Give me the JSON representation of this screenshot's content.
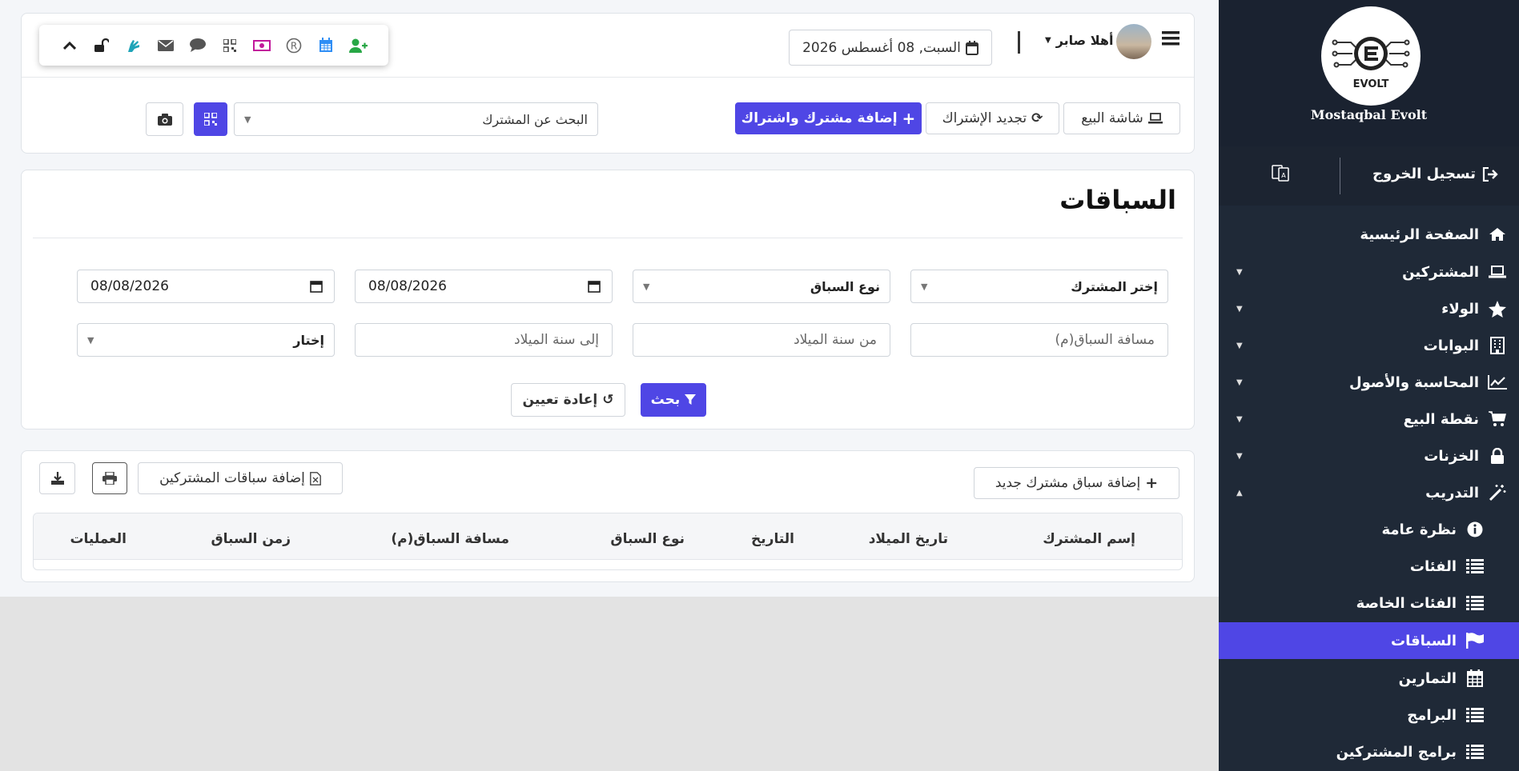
{
  "quickbar": {
    "icons": [
      "chevron-up-icon",
      "unlock-icon",
      "sign-language-icon",
      "envelope-icon",
      "comment-icon",
      "qrcode-icon",
      "money-bill-icon",
      "registered-icon",
      "calendar-icon",
      "user-plus-icon"
    ]
  },
  "header": {
    "date": "السبت, 08 أغسطس 2026",
    "greeting": "أهلا صابر"
  },
  "toolbar": {
    "pos_screen": "شاشة البيع",
    "renew": "تجديد الإشتراك",
    "add_subscriber": "إضافة مشترك واشتراك",
    "search_placeholder": "البحث عن المشترك"
  },
  "page": {
    "title": "السباقات"
  },
  "filters": {
    "subscriber_select": "إختر المشترك",
    "race_type_select": "نوع السباق",
    "date_from": "08/08/2026",
    "date_to": "08/08/2026",
    "distance_placeholder": "مسافة السباق(م)",
    "from_birth_year_placeholder": "من سنة الميلاد",
    "to_birth_year_placeholder": "إلى سنة الميلاد",
    "choose_select": "إختار",
    "search_button": "بحث",
    "reset_button": "إعادة تعيين"
  },
  "table_toolbar": {
    "add_new_racer": "إضافة سباق مشترك جديد",
    "add_races": "إضافة سباقات المشتركين"
  },
  "table": {
    "columns": [
      "إسم المشترك",
      "تاريخ الميلاد",
      "التاريخ",
      "نوع السباق",
      "مسافة السباق(م)",
      "زمن السباق",
      "العمليات"
    ]
  },
  "sidebar": {
    "brand": "Mostaqbal Evolt",
    "logo_text": "EVOLT",
    "logout": "تسجيل الخروج",
    "items": [
      {
        "label": "الصفحة الرئيسية",
        "icon": "home-icon"
      },
      {
        "label": "المشتركين",
        "icon": "laptop-icon"
      },
      {
        "label": "الولاء",
        "icon": "star-icon"
      },
      {
        "label": "البوابات",
        "icon": "building-icon"
      },
      {
        "label": "المحاسبة والأصول",
        "icon": "chart-line-icon"
      },
      {
        "label": "نقطة البيع",
        "icon": "cart-icon"
      },
      {
        "label": "الخزنات",
        "icon": "lock-icon"
      },
      {
        "label": "التدريب",
        "icon": "magic-wand-icon"
      }
    ],
    "sub_items": [
      {
        "label": "نظرة عامة",
        "icon": "info-circle-icon"
      },
      {
        "label": "الفئات",
        "icon": "list-icon"
      },
      {
        "label": "الفئات الخاصة",
        "icon": "list-icon"
      },
      {
        "label": "السباقات",
        "icon": "flag-icon"
      },
      {
        "label": "التمارين",
        "icon": "calendar-icon"
      },
      {
        "label": "البرامج",
        "icon": "list-icon"
      },
      {
        "label": "برامج المشتركين",
        "icon": "list-icon"
      }
    ],
    "accent": "#4f46e5"
  }
}
